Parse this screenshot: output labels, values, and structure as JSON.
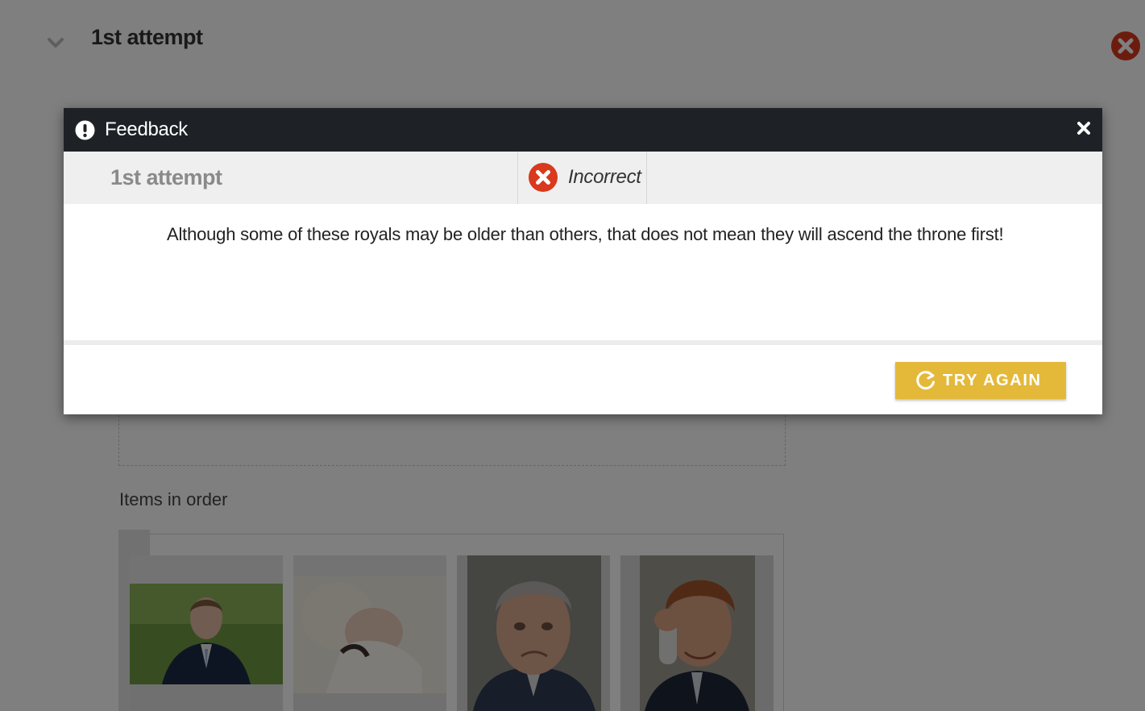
{
  "background": {
    "section_title": "1st attempt",
    "items_label": "Items in order",
    "cards": [
      {
        "name": "photo-card-1"
      },
      {
        "name": "photo-card-2"
      },
      {
        "name": "photo-card-3"
      },
      {
        "name": "photo-card-4"
      }
    ]
  },
  "modal": {
    "title": "Feedback",
    "attempt_label": "1st attempt",
    "result": "Incorrect",
    "message": "Although some of these royals may be older than others, that does not mean they will ascend the throne first!",
    "try_again_label": "TRY AGAIN"
  },
  "icons": {
    "collapse": "chevron-down-icon",
    "close_section": "close-circle-icon",
    "alert": "exclamation-circle-icon",
    "close_modal": "close-icon",
    "incorrect": "x-circle-icon",
    "retry": "refresh-icon"
  },
  "colors": {
    "header_bg": "#1e2226",
    "status_bg": "#efefef",
    "incorrect_red": "#d9391c",
    "button_gold": "#e4b93a"
  }
}
